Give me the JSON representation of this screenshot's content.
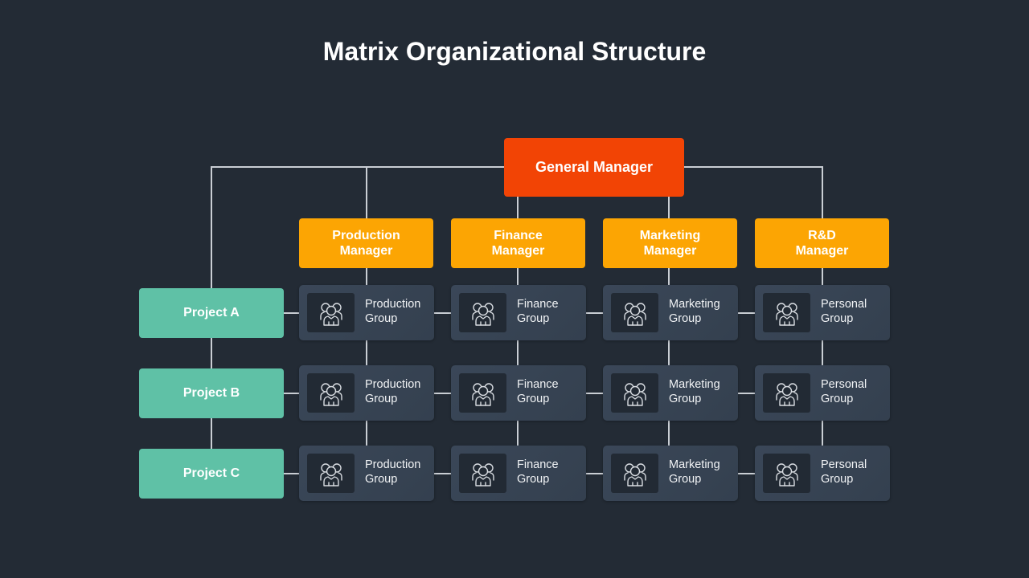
{
  "title": "Matrix Organizational Structure",
  "general_manager": {
    "label": "General Manager",
    "color": "#f24405"
  },
  "managers": [
    {
      "label": "Production\nManager"
    },
    {
      "label": "Finance\nManager"
    },
    {
      "label": "Marketing\nManager"
    },
    {
      "label": "R&D\nManager"
    }
  ],
  "manager_color": "#fca503",
  "projects": [
    {
      "label": "Project A"
    },
    {
      "label": "Project B"
    },
    {
      "label": "Project C"
    }
  ],
  "project_color": "#5fc1a6",
  "groups": [
    [
      {
        "label": "Production\nGroup",
        "icon": "people-group-icon"
      },
      {
        "label": "Finance\nGroup",
        "icon": "people-group-icon"
      },
      {
        "label": "Marketing\nGroup",
        "icon": "people-group-icon"
      },
      {
        "label": "Personal\nGroup",
        "icon": "people-group-icon"
      }
    ],
    [
      {
        "label": "Production\nGroup",
        "icon": "people-group-icon"
      },
      {
        "label": "Finance\nGroup",
        "icon": "people-group-icon"
      },
      {
        "label": "Marketing\nGroup",
        "icon": "people-group-icon"
      },
      {
        "label": "Personal\nGroup",
        "icon": "people-group-icon"
      }
    ],
    [
      {
        "label": "Production\nGroup",
        "icon": "people-group-icon"
      },
      {
        "label": "Finance\nGroup",
        "icon": "people-group-icon"
      },
      {
        "label": "Marketing\nGroup",
        "icon": "people-group-icon"
      },
      {
        "label": "Personal\nGroup",
        "icon": "people-group-icon"
      }
    ]
  ],
  "line_color": "#c9ced4",
  "background_color": "#232b35"
}
